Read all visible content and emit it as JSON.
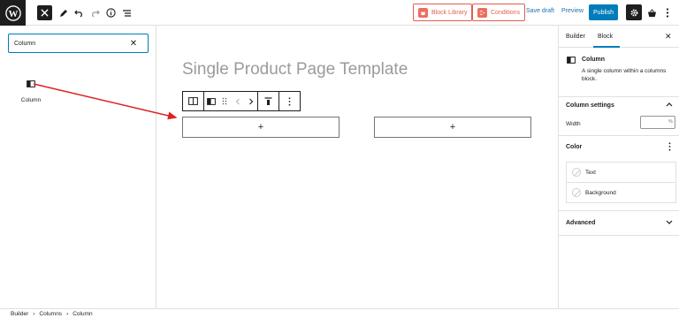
{
  "topbar": {
    "block_library_label": "Block Library",
    "conditions_label": "Conditions",
    "save_draft_label": "Save draft",
    "preview_label": "Preview",
    "publish_label": "Publish"
  },
  "inserter": {
    "search_value": "Column",
    "result_label": "Column"
  },
  "canvas": {
    "title": "Single Product Page Template",
    "column_placeholder": "+"
  },
  "sidebar": {
    "tabs": [
      "Builder",
      "Block"
    ],
    "active_tab": "Block",
    "block_name": "Column",
    "block_description": "A single column within a columns block.",
    "column_settings_title": "Column settings",
    "width_label": "Width",
    "width_unit": "%",
    "color_title": "Color",
    "color_items": [
      "Text",
      "Background"
    ],
    "advanced_title": "Advanced"
  },
  "breadcrumb": [
    "Builder",
    "Columns",
    "Column"
  ],
  "colors": {
    "accent": "#007cba",
    "brand_red": "#e25e52",
    "annotation_arrow": "#e02020"
  }
}
